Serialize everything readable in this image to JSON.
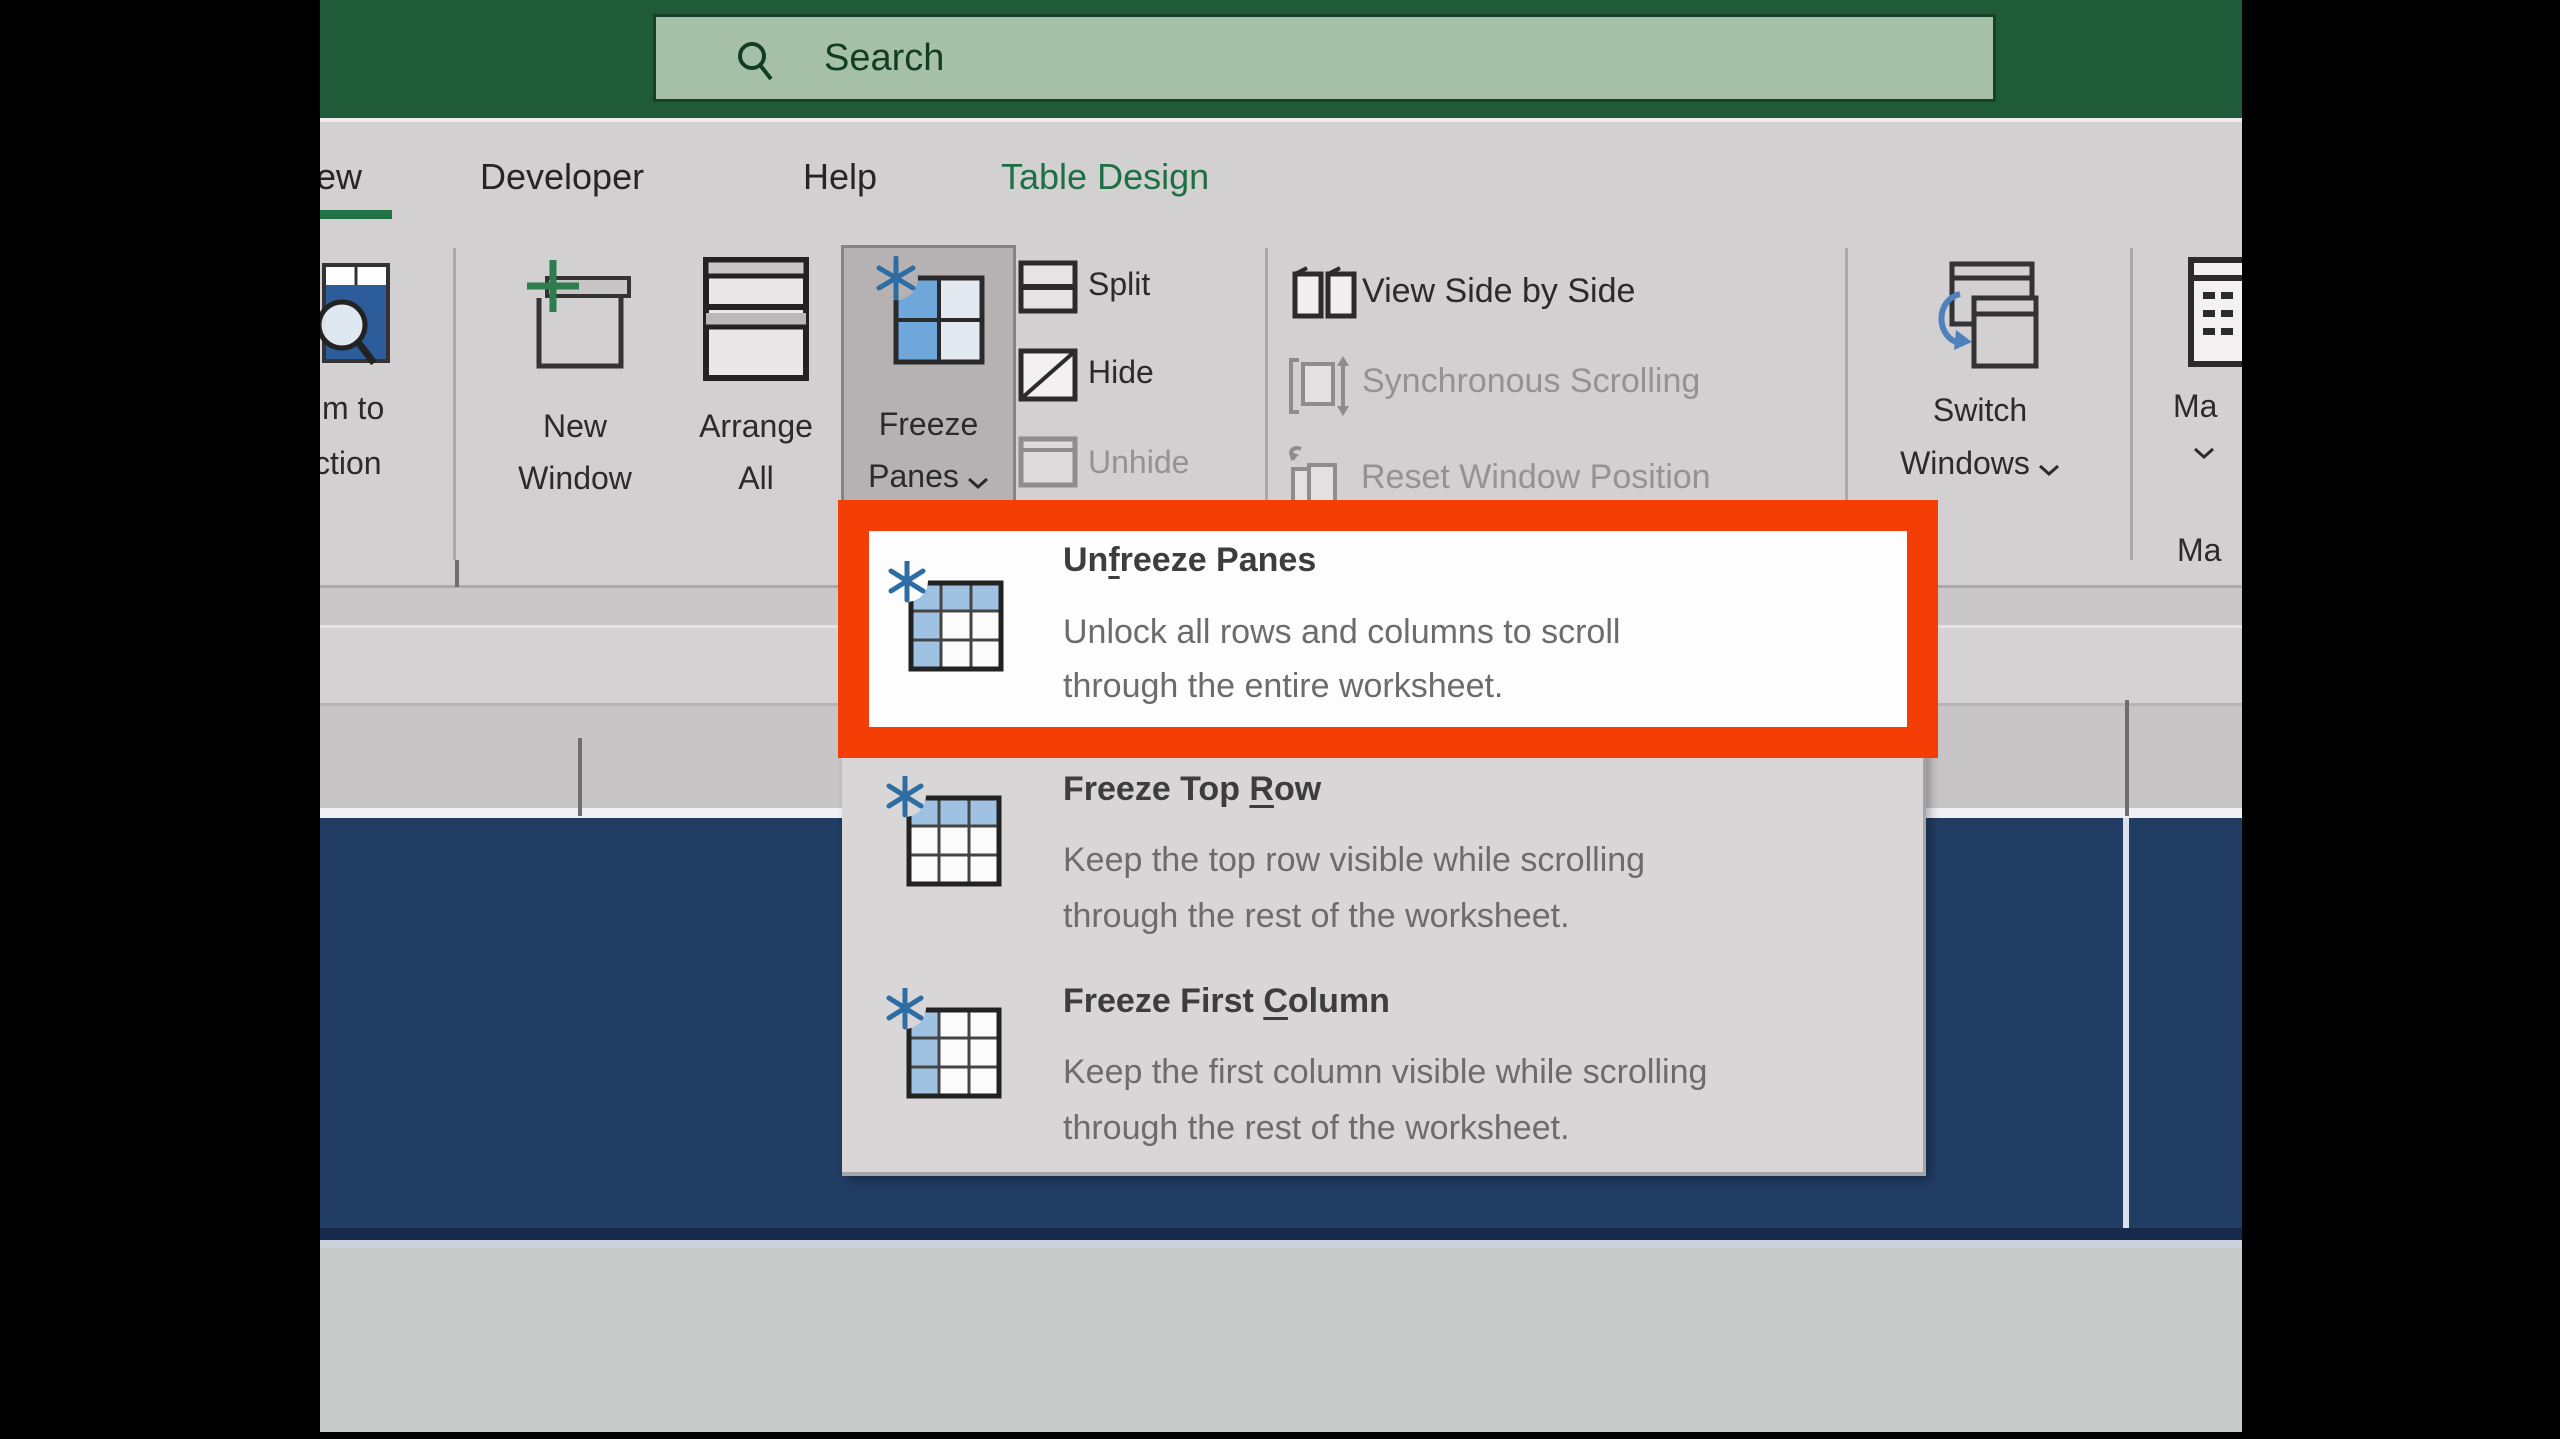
{
  "titlebar": {
    "search_placeholder": "Search"
  },
  "tabs": {
    "view_partial": "ew",
    "developer": "Developer",
    "help": "Help",
    "table_design": "Table Design"
  },
  "ribbon": {
    "zoom_to_selection_partial": {
      "line1": "m to",
      "line2": "ction"
    },
    "new_window": {
      "line1": "New",
      "line2": "Window"
    },
    "arrange_all": {
      "line1": "Arrange",
      "line2": "All"
    },
    "freeze_panes": {
      "line1": "Freeze",
      "line2": "Panes"
    },
    "split": "Split",
    "hide": "Hide",
    "unhide": "Unhide",
    "view_side_by_side": "View Side by Side",
    "synchronous_scrolling": "Synchronous Scrolling",
    "reset_window_position": "Reset Window Position",
    "switch_windows": {
      "line1": "Switch",
      "line2": "Windows"
    },
    "macros": {
      "button_partial": "Ma",
      "group_partial": "Ma"
    }
  },
  "menu": {
    "items": [
      {
        "title_pre": "Un",
        "title_key": "f",
        "title_post": "reeze Panes",
        "desc_line1": "Unlock all rows and columns to scroll",
        "desc_line2": "through the entire worksheet.",
        "highlighted": "true"
      },
      {
        "title_pre": "Freeze Top ",
        "title_key": "R",
        "title_post": "ow",
        "desc_line1": "Keep the top row visible while scrolling",
        "desc_line2": "through the rest of the worksheet."
      },
      {
        "title_pre": "Freeze First ",
        "title_key": "C",
        "title_post": "olumn",
        "desc_line1": "Keep the first column visible while scrolling",
        "desc_line2": "through the rest of the worksheet."
      }
    ]
  },
  "colors": {
    "excel_green": "#1f5b38",
    "accent_green": "#217346",
    "annotation_red": "#f43e06",
    "icon_blue": "#2e6da4",
    "worksheet_navy": "#213d64"
  }
}
